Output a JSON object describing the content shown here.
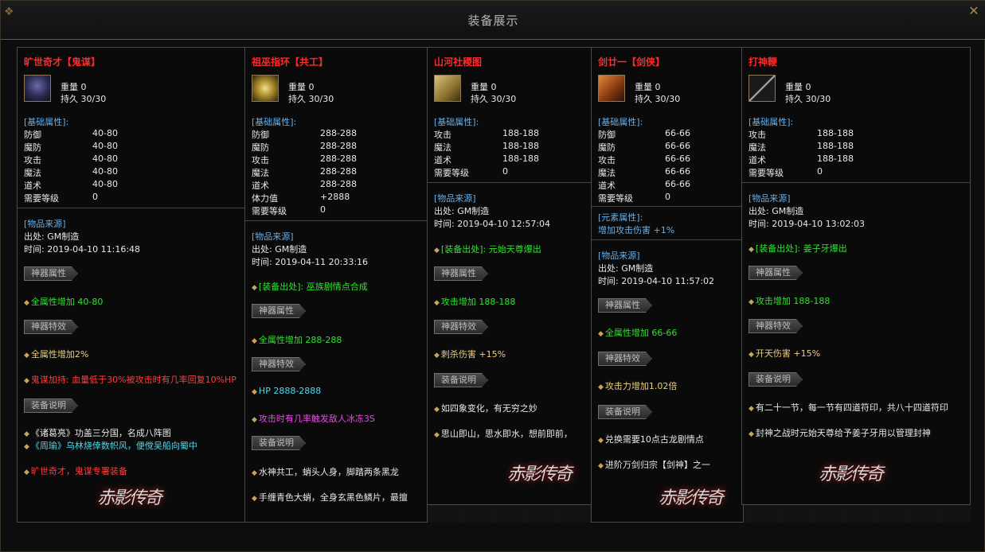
{
  "window": {
    "title": "装备展示"
  },
  "cards": [
    {
      "name": "旷世奇才【鬼谋】",
      "weight": "重量 0",
      "durability": "持久 30/30",
      "base_header": "[基础属性]:",
      "attrs": [
        {
          "name": "防御",
          "value": "40-80"
        },
        {
          "name": "魔防",
          "value": "40-80"
        },
        {
          "name": "攻击",
          "value": "40-80"
        },
        {
          "name": "魔法",
          "value": "40-80"
        },
        {
          "name": "道术",
          "value": "40-80"
        },
        {
          "name": "需要等级",
          "value": "0"
        }
      ],
      "source_header": "[物品来源]",
      "source_from": "出处: GM制造",
      "source_time": "时间: 2019-04-10 11:16:48",
      "btn_artifact": "神器属性",
      "artifact_attr": "全属性增加 40-80",
      "btn_effect": "神器特效",
      "effect_1": "全属性增加2%",
      "effect_2": "鬼谋加持: 血量低于30%被攻击时有几率回复10%HP",
      "btn_desc": "装备说明",
      "desc_1": "《诸葛亮》功盖三分国，名成八阵图",
      "desc_2": "《周瑜》乌林烧倖数帜风，便傥吴船向蜀中",
      "desc_3": "旷世奇才，鬼谋专署装备"
    },
    {
      "name": "祖巫指环【共工】",
      "weight": "重量 0",
      "durability": "持久 30/30",
      "base_header": "[基础属性]:",
      "attrs": [
        {
          "name": "防御",
          "value": "288-288"
        },
        {
          "name": "魔防",
          "value": "288-288"
        },
        {
          "name": "攻击",
          "value": "288-288"
        },
        {
          "name": "魔法",
          "value": "288-288"
        },
        {
          "name": "道术",
          "value": "288-288"
        },
        {
          "name": "体力值",
          "value": "+2888"
        },
        {
          "name": "需要等级",
          "value": "0"
        }
      ],
      "source_header": "[物品来源]",
      "source_from": "出处: GM制造",
      "source_time": "时间: 2019-04-11 20:33:16",
      "drop": "[装备出处]: 巫族剧情点合成",
      "btn_artifact": "神器属性",
      "artifact_attr": "全属性增加 288-288",
      "btn_effect": "神器特效",
      "effect_1": "HP 2888-2888",
      "effect_2": "攻击时有几率触发敌人冰冻3S",
      "btn_desc": "装备说明",
      "desc_1": "水神共工，蛸头人身，脚踏两条黑龙",
      "desc_2": "手缠青色大蛸，全身玄黑色鳞片，最擅"
    },
    {
      "name": "山河社稷图",
      "weight": "重量 0",
      "durability": "持久 30/30",
      "base_header": "[基础属性]:",
      "attrs": [
        {
          "name": "攻击",
          "value": "188-188"
        },
        {
          "name": "魔法",
          "value": "188-188"
        },
        {
          "name": "道术",
          "value": "188-188"
        },
        {
          "name": "需要等级",
          "value": "0"
        }
      ],
      "source_header": "[物品来源]",
      "source_from": "出处: GM制造",
      "source_time": "时间: 2019-04-10 12:57:04",
      "drop": "[装备出处]: 元始天尊爆出",
      "btn_artifact": "神器属性",
      "artifact_attr": "攻击增加 188-188",
      "btn_effect": "神器特效",
      "effect_1": "刺杀伤害 +15%",
      "btn_desc": "装备说明",
      "desc_1": "如四象变化，有无穷之妙",
      "desc_2": "思山即山，思水即水，想前即前，"
    },
    {
      "name": "剑廿一【剑侠】",
      "weight": "重量 0",
      "durability": "持久 30/30",
      "base_header": "[基础属性]:",
      "attrs": [
        {
          "name": "防御",
          "value": "66-66"
        },
        {
          "name": "魔防",
          "value": "66-66"
        },
        {
          "name": "攻击",
          "value": "66-66"
        },
        {
          "name": "魔法",
          "value": "66-66"
        },
        {
          "name": "道术",
          "value": "66-66"
        },
        {
          "name": "需要等级",
          "value": "0"
        }
      ],
      "element_header": "[元素属性]:",
      "element_value": "增加攻击伤害  +1%",
      "source_header": "[物品来源]",
      "source_from": "出处: GM制造",
      "source_time": "时间: 2019-04-10 11:57:02",
      "btn_artifact": "神器属性",
      "artifact_attr": "全属性增加 66-66",
      "btn_effect": "神器特效",
      "effect_1": "攻击力增加1.02倍",
      "btn_desc": "装备说明",
      "desc_1": "兑换需要10点古龙剧情点",
      "desc_2": "进阶万剑归宗【剑神】之一"
    },
    {
      "name": "打神鞭",
      "weight": "重量 0",
      "durability": "持久 30/30",
      "base_header": "[基础属性]:",
      "attrs": [
        {
          "name": "攻击",
          "value": "188-188"
        },
        {
          "name": "魔法",
          "value": "188-188"
        },
        {
          "name": "道术",
          "value": "188-188"
        },
        {
          "name": "需要等级",
          "value": "0"
        }
      ],
      "source_header": "[物品来源]",
      "source_from": "出处: GM制造",
      "source_time": "时间: 2019-04-10 13:02:03",
      "drop": "[装备出处]: 姜子牙爆出",
      "btn_artifact": "神器属性",
      "artifact_attr": "攻击增加 188-188",
      "btn_effect": "神器特效",
      "effect_1": "开天伤害 +15%",
      "btn_desc": "装备说明",
      "desc_1": "有二十一节，每一节有四道符印，共八十四道符印",
      "desc_2": "封神之战时元始天尊给予姜子牙用以管理封神"
    }
  ],
  "logo_text": "赤影传奇"
}
